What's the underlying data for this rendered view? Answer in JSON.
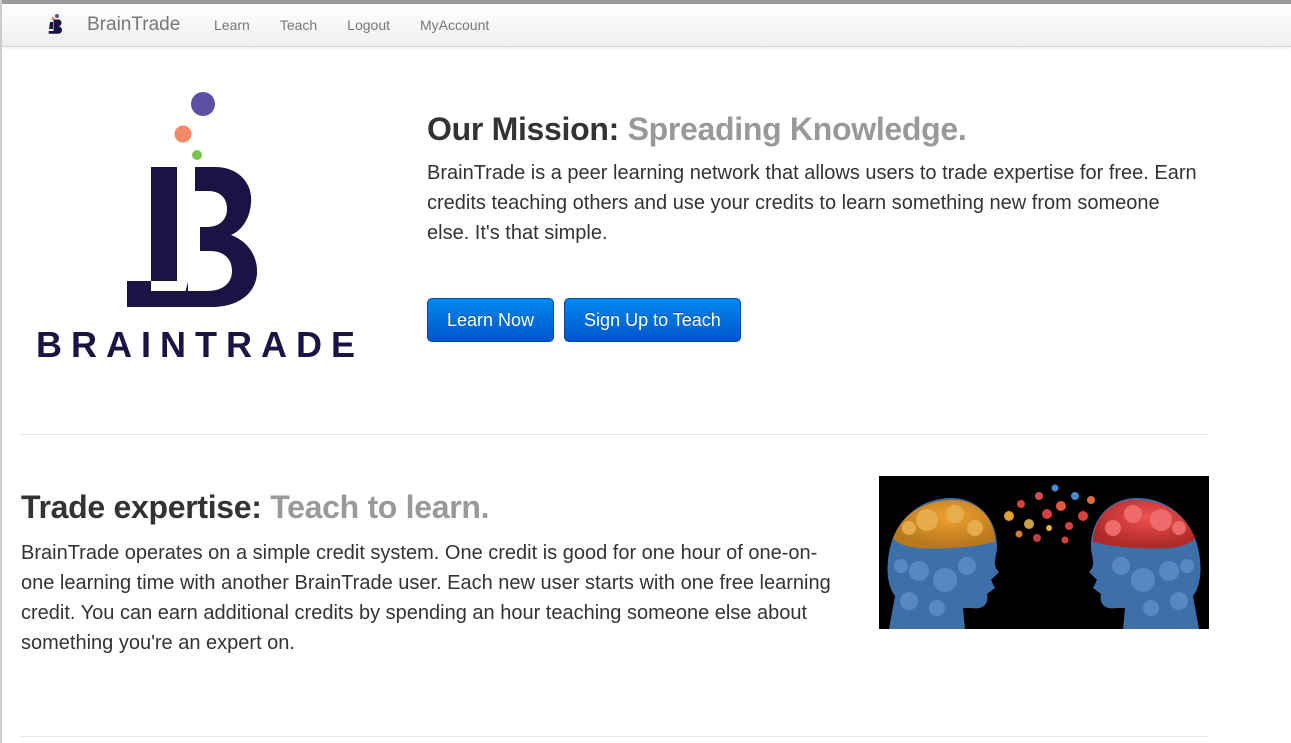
{
  "navbar": {
    "brand": "BrainTrade",
    "links": [
      "Learn",
      "Teach",
      "Logout",
      "MyAccount"
    ]
  },
  "logo": {
    "wordmark": "BRAINTRADE"
  },
  "mission": {
    "heading_strong": "Our Mission:",
    "heading_muted": "Spreading Knowledge.",
    "text": "BrainTrade is a peer learning network that allows users to trade expertise for free. Earn credits teaching others and use your credits to learn something new from someone else. It's that simple.",
    "buttons": {
      "learn_now": "Learn Now",
      "sign_up_teach": "Sign Up to Teach"
    }
  },
  "trade": {
    "heading_strong": "Trade expertise:",
    "heading_muted": "Teach to learn.",
    "text": "BrainTrade operates on a simple credit system. One credit is good for one hour of one-on-one learning time with another BrainTrade user. Each new user starts with one free learning credit. You can earn additional credits by spending an hour teaching someone else about something you're an expert on."
  },
  "colors": {
    "brand_navy": "#1a1444",
    "dot_purple": "#5b4fa3",
    "dot_orange": "#f28a68",
    "dot_green": "#7cc24f",
    "button_blue": "#0066dd",
    "muted_heading": "#999999"
  },
  "icons": {
    "nav_logo": "braintrade-logo-icon",
    "illustration": "heads-with-gears-illustration"
  }
}
